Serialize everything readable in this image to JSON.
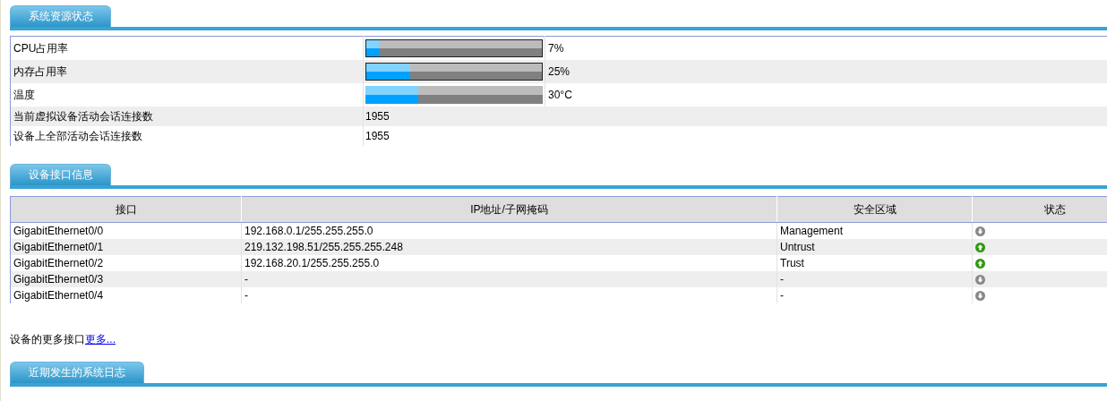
{
  "sections": [
    {
      "title": "系统资源状态"
    },
    {
      "title": "设备接口信息"
    },
    {
      "title": "近期发生的系统日志"
    }
  ],
  "resources": [
    {
      "label": "CPU占用率",
      "kind": "bar",
      "level": 0.07,
      "reading": "7%"
    },
    {
      "label": "内存占用率",
      "kind": "bar",
      "level": 0.25,
      "reading": "25%"
    },
    {
      "label": "温度",
      "kind": "bar",
      "level": 0.3,
      "reading": "30°C"
    },
    {
      "label": "当前虚拟设备活动会话连接数",
      "kind": "text",
      "reading": "1955"
    },
    {
      "label": "设备上全部活动会话连接数",
      "kind": "text",
      "reading": "1955"
    }
  ],
  "interfaces": {
    "columns": [
      "接口",
      "IP地址/子网掩码",
      "安全区域",
      "状态"
    ],
    "rows": [
      {
        "name": "GigabitEthernet0/0",
        "ip": "192.168.0.1/255.255.255.0",
        "zone": "Management",
        "up": false
      },
      {
        "name": "GigabitEthernet0/1",
        "ip": "219.132.198.51/255.255.255.248",
        "zone": "Untrust",
        "up": true
      },
      {
        "name": "GigabitEthernet0/2",
        "ip": "192.168.20.1/255.255.255.0",
        "zone": "Trust",
        "up": true
      },
      {
        "name": "GigabitEthernet0/3",
        "ip": "-",
        "zone": "-",
        "up": false
      },
      {
        "name": "GigabitEthernet0/4",
        "ip": "-",
        "zone": "-",
        "up": false
      }
    ]
  },
  "more": {
    "text": "设备的更多接口",
    "link": "更多..."
  }
}
